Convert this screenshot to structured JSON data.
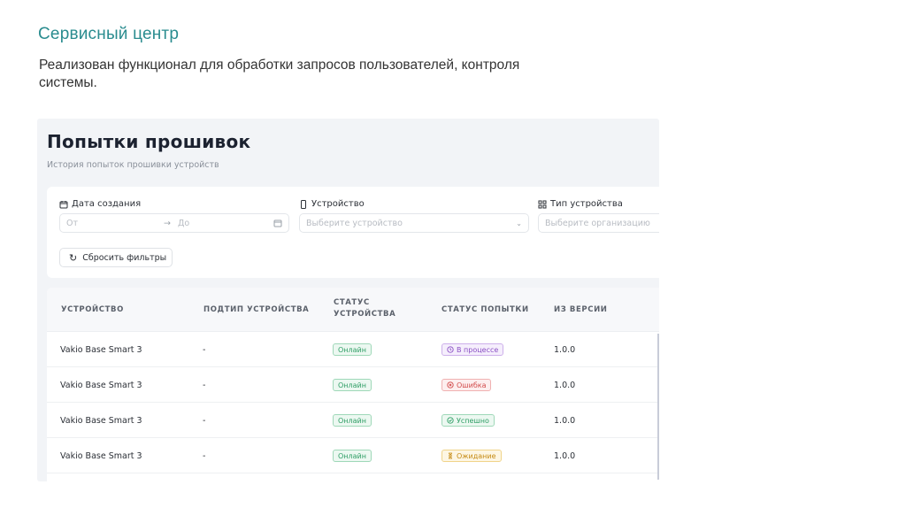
{
  "slide": {
    "title": "Сервисный центр",
    "description": "Реализован функционал для обработки запросов пользователей, контроля системы."
  },
  "page": {
    "title": "Попытки прошивок",
    "subtitle": "История попыток прошивки устройств"
  },
  "filters": {
    "date": {
      "label": "Дата создания",
      "from_placeholder": "От",
      "to_placeholder": "До"
    },
    "device": {
      "label": "Устройство",
      "placeholder": "Выберите устройство"
    },
    "device_type": {
      "label": "Тип устройства",
      "placeholder": "Выберите организацию"
    },
    "reset_label": "Сбросить фильтры"
  },
  "table": {
    "columns": [
      "Устройство",
      "Подтип устройства",
      "Статус устройства",
      "Статус попытки",
      "Из версии"
    ],
    "rows": [
      {
        "device": "Vakio Base Smart 3",
        "subtype": "-",
        "device_status": "Онлайн",
        "attempt_status": "В процессе",
        "attempt_kind": "progress",
        "from_version": "1.0.0"
      },
      {
        "device": "Vakio Base Smart 3",
        "subtype": "-",
        "device_status": "Онлайн",
        "attempt_status": "Ошибка",
        "attempt_kind": "error",
        "from_version": "1.0.0"
      },
      {
        "device": "Vakio Base Smart 3",
        "subtype": "-",
        "device_status": "Онлайн",
        "attempt_status": "Успешно",
        "attempt_kind": "success",
        "from_version": "1.0.0"
      },
      {
        "device": "Vakio Base Smart 3",
        "subtype": "-",
        "device_status": "Онлайн",
        "attempt_status": "Ожидание",
        "attempt_kind": "waiting",
        "from_version": "1.0.0"
      }
    ]
  },
  "colors": {
    "accent": "#2a8c8f",
    "online": "#2f9e65",
    "progress": "#8a4fc4",
    "error": "#d24a4a",
    "success": "#2f9e65",
    "waiting": "#c58a13"
  }
}
